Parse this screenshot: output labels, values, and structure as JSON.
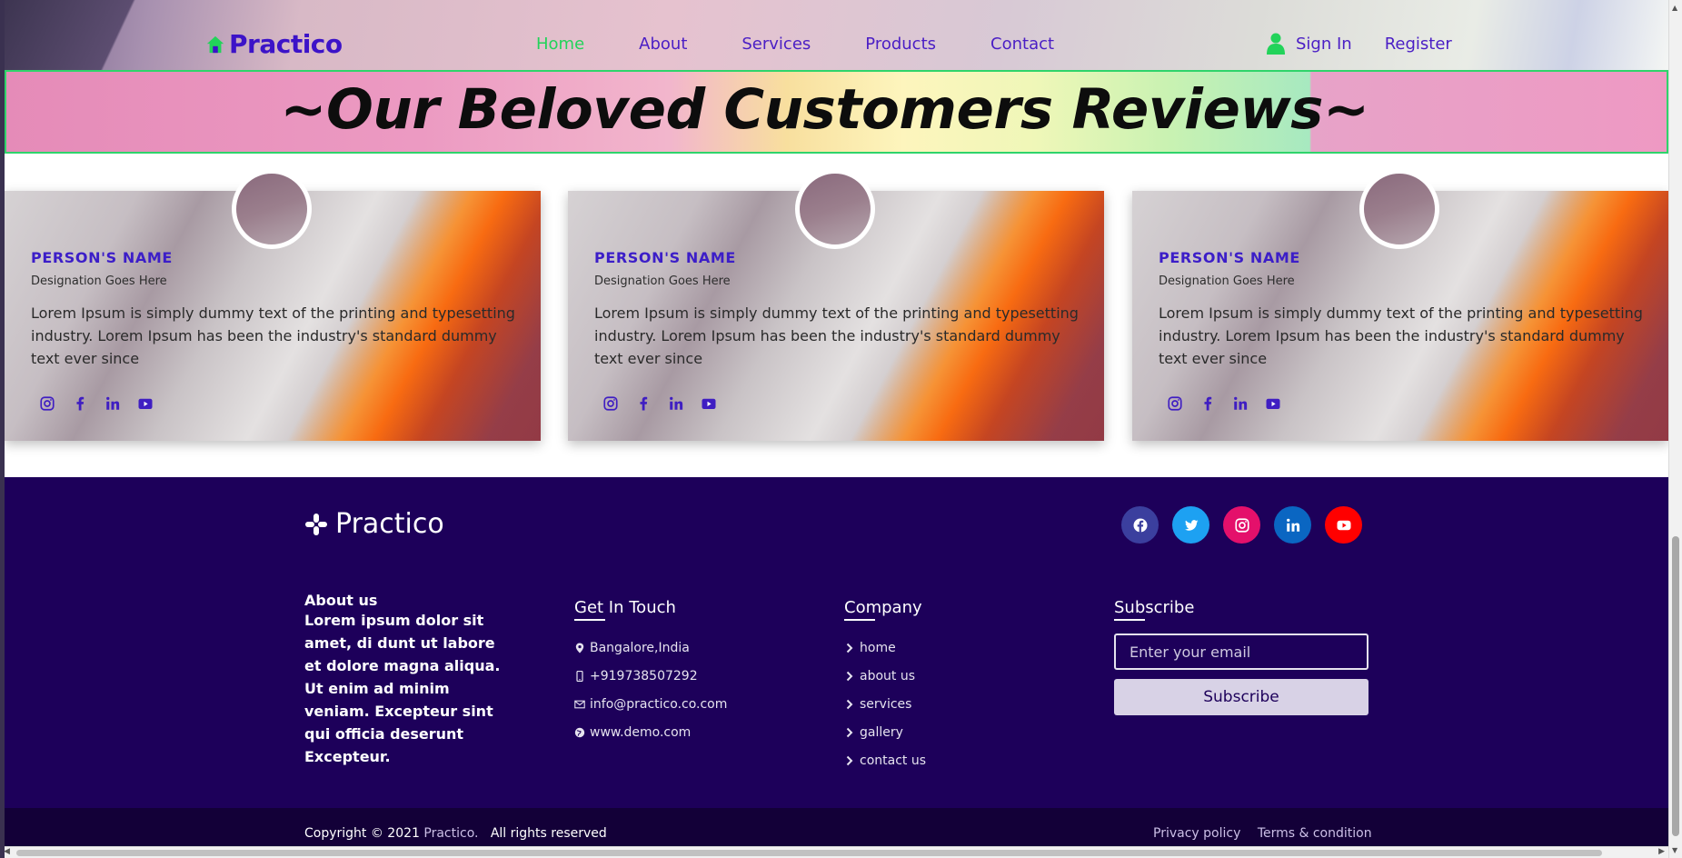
{
  "header": {
    "brand": "Practico",
    "nav": [
      "Home",
      "About",
      "Services",
      "Products",
      "Contact"
    ],
    "active_nav": "Home",
    "sign_in": "Sign In",
    "register": "Register"
  },
  "banner": {
    "title": "~Our Beloved Customers Reviews~"
  },
  "cards": [
    {
      "name": "PERSON'S NAME",
      "designation": "Designation Goes Here",
      "text": "Lorem Ipsum is simply dummy text of the printing and typesetting industry. Lorem Ipsum has been the industry's standard dummy text ever since"
    },
    {
      "name": "PERSON'S NAME",
      "designation": "Designation Goes Here",
      "text": "Lorem Ipsum is simply dummy text of the printing and typesetting industry. Lorem Ipsum has been the industry's standard dummy text ever since"
    },
    {
      "name": "PERSON'S NAME",
      "designation": "Designation Goes Here",
      "text": "Lorem Ipsum is simply dummy text of the printing and typesetting industry. Lorem Ipsum has been the industry's standard dummy text ever since"
    }
  ],
  "card_social_icons": [
    "instagram-icon",
    "facebook-icon",
    "linkedin-icon",
    "youtube-icon"
  ],
  "footer": {
    "brand": "Practico",
    "social": [
      {
        "icon": "facebook-icon",
        "color": "#3b3f9e"
      },
      {
        "icon": "twitter-icon",
        "color": "#1da1f2"
      },
      {
        "icon": "instagram-icon",
        "color": "#e4106b"
      },
      {
        "icon": "linkedin-icon",
        "color": "#0a66c2"
      },
      {
        "icon": "youtube-icon",
        "color": "#ff0000"
      }
    ],
    "about": {
      "title": "About us",
      "text": "Lorem ipsum dolor sit amet, di dunt ut labore et dolore magna aliqua. Ut enim ad minim veniam. Excepteur sint qui officia deserunt Excepteur."
    },
    "touch": {
      "title": "Get In Touch",
      "location": "Bangalore,India",
      "phone": "+919738507292",
      "email": "info@practico.co.com",
      "web": "www.demo.com"
    },
    "company": {
      "title": "Company",
      "links": [
        "home",
        "about us",
        "services",
        "gallery",
        "contact us"
      ]
    },
    "subscribe": {
      "title": "Subscribe",
      "placeholder": "Enter your email",
      "button": "Subscribe"
    },
    "copyright_prefix": "Copyright © 2021",
    "copyright_brand": "Practico.",
    "copyright_suffix": "All rights reserved",
    "privacy": "Privacy policy",
    "terms": "Terms & condition"
  },
  "colors": {
    "brand": "#3c13c8",
    "active_nav": "#22d35a",
    "footer_bg": "#1d005a",
    "footer_bottom_bg": "#130038"
  }
}
